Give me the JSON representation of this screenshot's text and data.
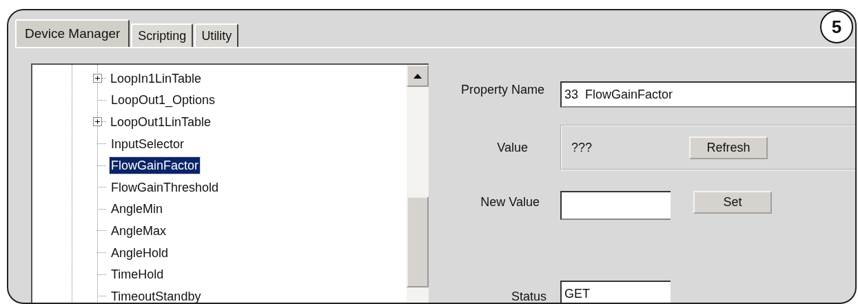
{
  "badge": "5",
  "tabs": [
    {
      "label": "Device Manager",
      "selected": true
    },
    {
      "label": "Scripting",
      "selected": false
    },
    {
      "label": "Utility",
      "selected": false
    }
  ],
  "tree": {
    "items": [
      {
        "label": "LoopIn1LinTable",
        "kind": "collapsed",
        "selected": false
      },
      {
        "label": "LoopOut1_Options",
        "kind": "leaf",
        "selected": false
      },
      {
        "label": "LoopOut1LinTable",
        "kind": "collapsed",
        "selected": false
      },
      {
        "label": "InputSelector",
        "kind": "leaf",
        "selected": false
      },
      {
        "label": "FlowGainFactor",
        "kind": "leaf",
        "selected": true
      },
      {
        "label": "FlowGainThreshold",
        "kind": "leaf",
        "selected": false
      },
      {
        "label": "AngleMin",
        "kind": "leaf",
        "selected": false
      },
      {
        "label": "AngleMax",
        "kind": "leaf",
        "selected": false
      },
      {
        "label": "AngleHold",
        "kind": "leaf",
        "selected": false
      },
      {
        "label": "TimeHold",
        "kind": "leaf",
        "selected": false
      },
      {
        "label": "TimeoutStandby",
        "kind": "leaf",
        "selected": false
      }
    ]
  },
  "properties": {
    "property_name": {
      "label": "Property Name",
      "value": "33  FlowGainFactor"
    },
    "value": {
      "label": "Value",
      "value": "???",
      "button": "Refresh"
    },
    "new_value": {
      "label": "New Value",
      "button": "Set"
    },
    "status": {
      "label": "Status",
      "value": "GET"
    }
  }
}
